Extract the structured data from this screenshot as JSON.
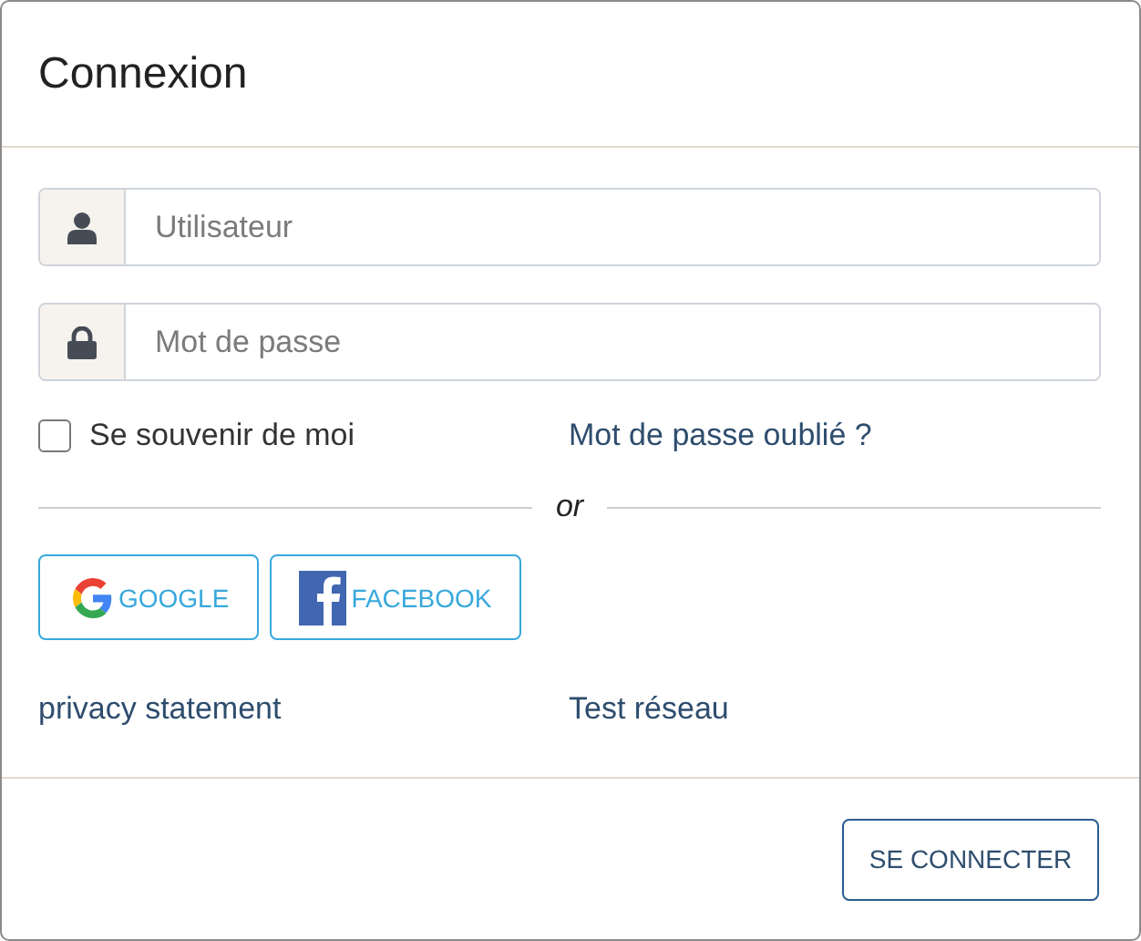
{
  "dialog": {
    "title": "Connexion"
  },
  "fields": [
    {
      "kind": "user",
      "placeholder": "Utilisateur"
    },
    {
      "kind": "lock",
      "placeholder": "Mot de passe"
    }
  ],
  "remember": {
    "label": "Se souvenir de moi",
    "checked": false
  },
  "forgot_link": "Mot de passe oublié ?",
  "divider": "or",
  "social_buttons": [
    {
      "kind": "google",
      "label": "GOOGLE"
    },
    {
      "kind": "facebook",
      "label": "FACEBOOK"
    }
  ],
  "links": [
    "privacy statement",
    "Test réseau"
  ],
  "submit": "SE CONNECTER"
}
